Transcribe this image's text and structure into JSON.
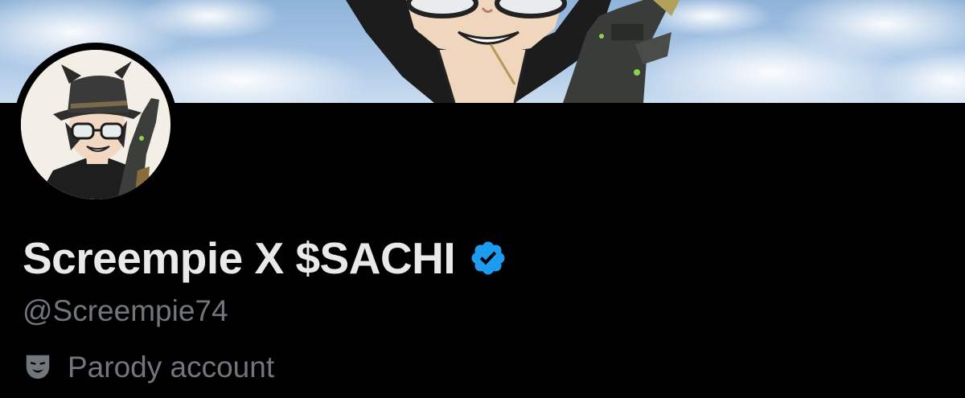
{
  "profile": {
    "display_name": "Screempie X $SACHI",
    "handle": "@Screempie74",
    "label": "Parody account",
    "verified": true,
    "verified_badge_color": "#1d9bf0",
    "label_icon": "theater-mask-icon"
  },
  "colors": {
    "background": "#000000",
    "name_text": "#e7e9ea",
    "secondary_text": "#71767b",
    "badge_blue": "#1d9bf0"
  }
}
